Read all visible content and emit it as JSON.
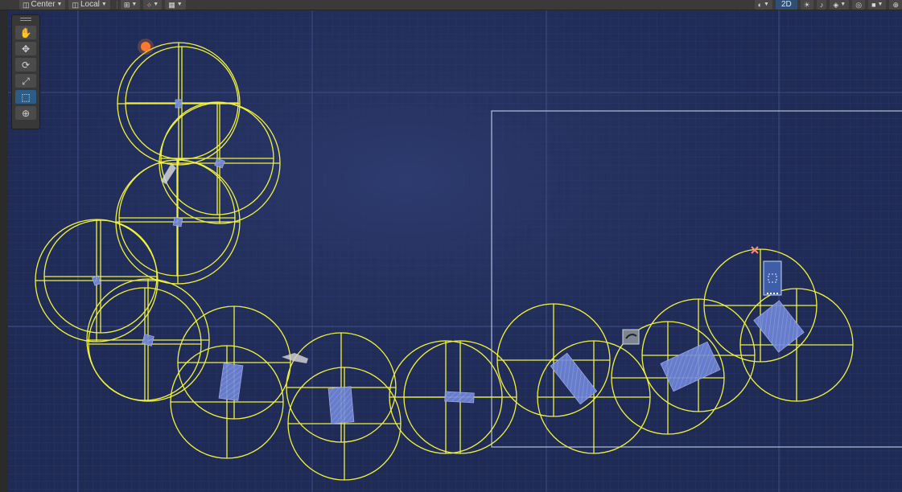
{
  "toolbar": {
    "pivot_label": "Center",
    "space_label": "Local",
    "view_mode_label": "2D",
    "left_icons": [
      "grid-snap-icon",
      "increment-snap-icon",
      "grid-visibility-icon"
    ],
    "right_icons": [
      "shading-mode-icon",
      "lighting-icon",
      "audio-icon",
      "effects-icon",
      "visibility-icon",
      "camera-icon",
      "gizmos-icon"
    ]
  },
  "tools": [
    {
      "name": "view-tool",
      "icon": "hand-icon",
      "glyph": "✋",
      "active": false
    },
    {
      "name": "move-tool",
      "icon": "move-icon",
      "glyph": "✥",
      "active": false
    },
    {
      "name": "rotate-tool",
      "icon": "rotate-icon",
      "glyph": "⟳",
      "active": false
    },
    {
      "name": "scale-tool",
      "icon": "scale-icon",
      "glyph": "⤢",
      "active": false
    },
    {
      "name": "rect-tool",
      "icon": "rect-icon",
      "glyph": "⬚",
      "active": true
    },
    {
      "name": "transform-tool",
      "icon": "transform-icon",
      "glyph": "⊕",
      "active": false
    }
  ],
  "colors": {
    "scene_background": "#1f2b55",
    "collider_gizmo": "#f2f23c",
    "sprite_fill": "#6f86d8",
    "selection_accent": "#2c5d87",
    "light_icon": "#ff7a2a"
  }
}
